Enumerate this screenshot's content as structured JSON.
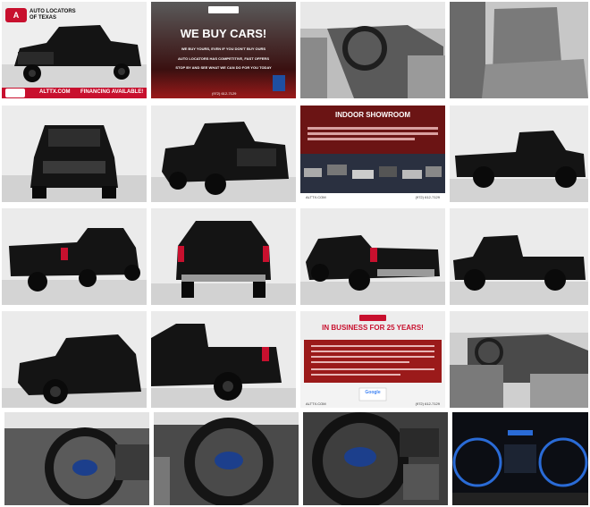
{
  "logo": {
    "line1": "AUTO LOCATORS",
    "line2": "OF TEXAS"
  },
  "banner": {
    "site": "ALTTX.COM",
    "financing": "FINANCING AVAILABLE!"
  },
  "buy_cars": {
    "title": "WE BUY CARS!",
    "line1": "WE BUY YOURS, EVEN IF YOU DON'T BUY OURS",
    "line2": "AUTO LOCATORS HAS COMPETITIVE, FAST OFFERS",
    "line3": "STOP BY AND SEE WHAT WE CAN DO FOR YOU TODAY",
    "phone": "(972) 612-7129"
  },
  "showroom": {
    "title": "INDOOR SHOWROOM",
    "site": "ALTTX.COM",
    "phone": "(972) 612-7129"
  },
  "business": {
    "title": "IN BUSINESS FOR 25 YEARS!",
    "google": "Google",
    "site": "ALTTX.COM",
    "phone": "(972) 612-7129"
  },
  "colors": {
    "red": "#c8102e",
    "dark_red": "#8b1a1a",
    "truck": "#141414",
    "studio": "#e6e6e6"
  }
}
